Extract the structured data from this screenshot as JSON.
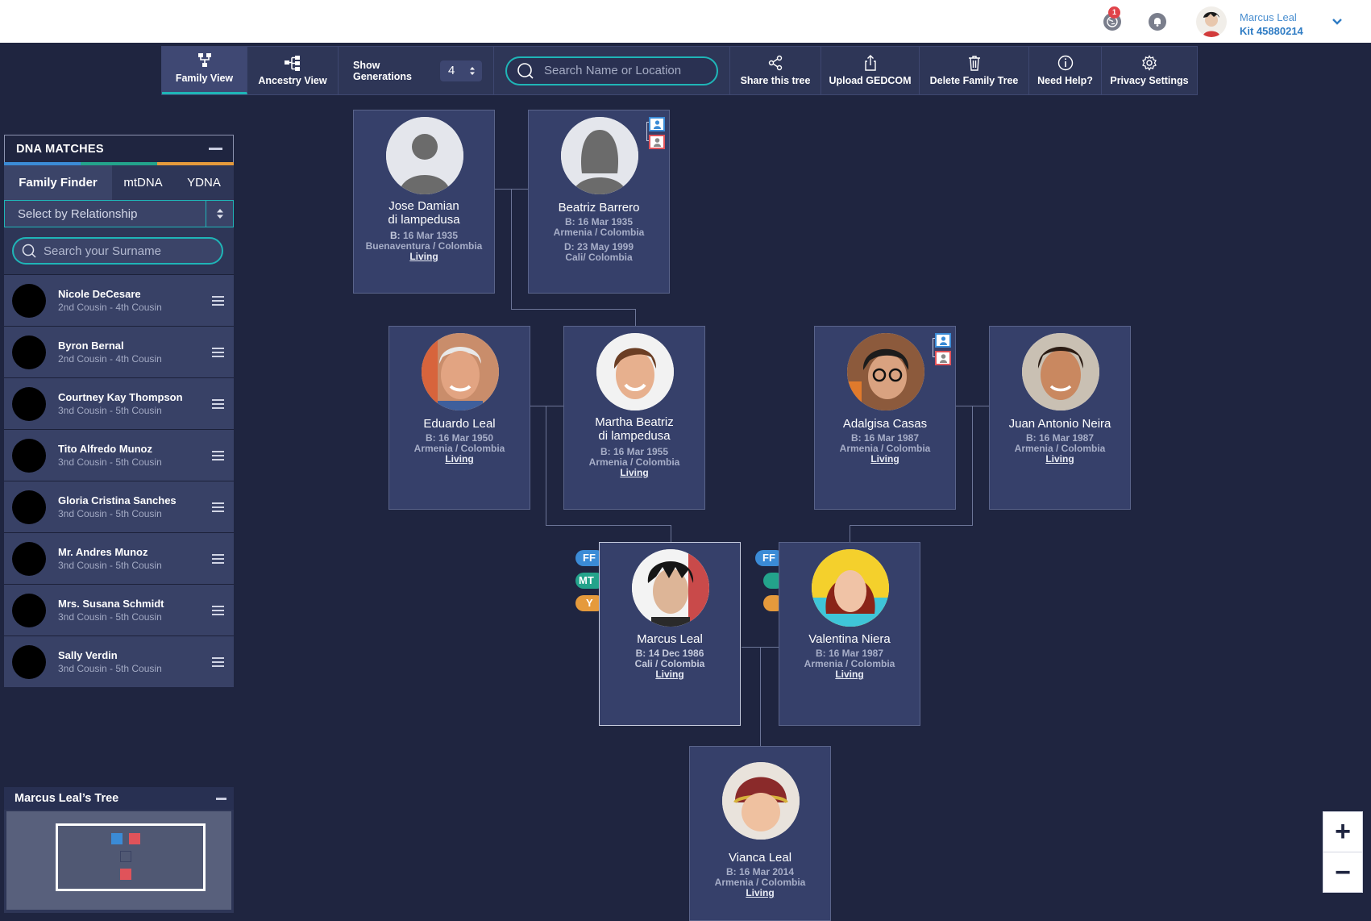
{
  "header": {
    "notification_count": "1",
    "user_name": "Marcus Leal",
    "user_kit": "Kit 45880214"
  },
  "toolbar": {
    "family_view": "Family View",
    "ancestry_view": "Ancestry View",
    "show_generations_label": "Show Generations",
    "generations_value": "4",
    "search_placeholder": "Search Name or Location",
    "share": "Share this tree",
    "upload": "Upload GEDCOM",
    "delete": "Delete Family Tree",
    "help": "Need Help?",
    "privacy": "Privacy Settings"
  },
  "dna": {
    "title": "DNA MATCHES",
    "tabs": [
      "Family Finder",
      "mtDNA",
      "YDNA"
    ],
    "tab_colors": [
      "#3b8bd6",
      "#23a38b",
      "#e59a3c"
    ],
    "relationship_select": "Select by Relationship",
    "surname_placeholder": "Search your Surname",
    "matches": [
      {
        "name": "Nicole DeCesare",
        "rel": "2nd Cousin - 4th Cousin"
      },
      {
        "name": "Byron Bernal",
        "rel": "2nd Cousin - 4th Cousin"
      },
      {
        "name": "Courtney Kay Thompson",
        "rel": "3nd Cousin - 5th Cousin"
      },
      {
        "name": "Tito Alfredo Munoz",
        "rel": "3nd Cousin - 5th Cousin"
      },
      {
        "name": "Gloria Cristina Sanches",
        "rel": "3nd Cousin - 5th Cousin"
      },
      {
        "name": "Mr. Andres Munoz",
        "rel": "3nd Cousin - 5th Cousin"
      },
      {
        "name": "Mrs. Susana Schmidt",
        "rel": "3nd Cousin - 5th Cousin"
      },
      {
        "name": "Sally Verdin",
        "rel": "3nd Cousin - 5th Cousin"
      }
    ]
  },
  "mini_tree": {
    "title": "Marcus Leal’s Tree"
  },
  "zoom": {
    "in": "+",
    "out": "−"
  },
  "people": {
    "jose": {
      "name": "Jose Damian\ndi lampedusa",
      "birth": "16 Mar 1935",
      "birth_place": "Buenaventura / Colombia",
      "status": "Living"
    },
    "beatriz": {
      "name": "Beatriz Barrero",
      "birth": "16 Mar 1935",
      "birth_place": "Armenia / Colombia",
      "death": "23 May 1999",
      "death_place": "Cali/ Colombia"
    },
    "eduardo": {
      "name": "Eduardo Leal",
      "birth": "16 Mar 1950",
      "birth_place": "Armenia / Colombia",
      "status": "Living"
    },
    "martha": {
      "name": "Martha Beatriz\ndi lampedusa",
      "birth": "16 Mar 1955",
      "birth_place": "Armenia / Colombia",
      "status": "Living"
    },
    "adalgisa": {
      "name": "Adalgisa Casas",
      "birth": "16 Mar 1987",
      "birth_place": "Armenia / Colombia",
      "status": "Living"
    },
    "juan": {
      "name": "Juan Antonio Neira",
      "birth": "16 Mar 1987",
      "birth_place": "Armenia / Colombia",
      "status": "Living"
    },
    "marcus": {
      "name": "Marcus Leal",
      "birth": "14 Dec 1986",
      "birth_place": "Cali / Colombia",
      "status": "Living"
    },
    "valentina": {
      "name": "Valentina Niera",
      "birth": "16 Mar 1987",
      "birth_place": "Armenia / Colombia",
      "status": "Living"
    },
    "vianca": {
      "name": "Vianca Leal",
      "birth": "16 Mar 2014",
      "birth_place": "Armenia / Colombia",
      "status": "Living"
    }
  },
  "labels": {
    "born": "B:",
    "died": "D:"
  },
  "badges": {
    "ff": "FF",
    "mt": "MT",
    "y": "Y"
  },
  "colors": {
    "accent": "#1fb5b7",
    "ff": "#3b8bd6",
    "mt": "#23a38b",
    "y": "#e59a3c",
    "male_icon": "#3b8bd6",
    "female_icon": "#e0535a"
  }
}
